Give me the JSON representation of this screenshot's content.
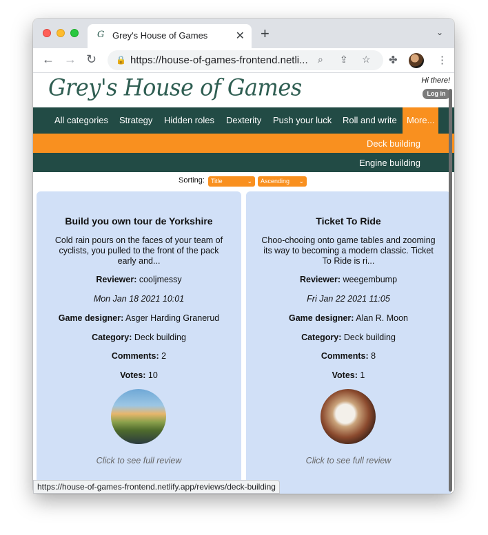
{
  "browser": {
    "tab_title": "Grey's House of Games",
    "tab_favicon": "G",
    "url": "https://house-of-games-frontend.netli...",
    "status_url": "https://house-of-games-frontend.netlify.app/reviews/deck-building"
  },
  "header": {
    "logo": "Grey's House of Games",
    "greeting": "Hi there!",
    "login_label": "Log in"
  },
  "nav": {
    "items": [
      "All categories",
      "Strategy",
      "Hidden roles",
      "Dexterity",
      "Push your luck",
      "Roll and write"
    ],
    "more_label": "More...",
    "dropdown": [
      "Deck building",
      "Engine building"
    ]
  },
  "sorting": {
    "label": "Sorting:",
    "sort_by": "Title",
    "order": "Ascending"
  },
  "reviews": [
    {
      "title": "Build you own tour de Yorkshire",
      "excerpt": "Cold rain pours on the faces of your team of cyclists, you pulled to the front of the pack early and...",
      "reviewer_label": "Reviewer:",
      "reviewer": "cooljmessy",
      "date": "Mon Jan 18 2021 10:01",
      "designer_label": "Game designer:",
      "designer": "Asger Harding Granerud",
      "category_label": "Category:",
      "category": "Deck building",
      "comments_label": "Comments:",
      "comments": "2",
      "votes_label": "Votes:",
      "votes": "10",
      "link": "Click to see full review"
    },
    {
      "title": "Ticket To Ride",
      "excerpt": "Choo-chooing onto game tables and zooming its way to becoming a modern classic. Ticket To Ride is ri...",
      "reviewer_label": "Reviewer:",
      "reviewer": "weegembump",
      "date": "Fri Jan 22 2021 11:05",
      "designer_label": "Game designer:",
      "designer": "Alan R. Moon",
      "category_label": "Category:",
      "category": "Deck building",
      "comments_label": "Comments:",
      "comments": "8",
      "votes_label": "Votes:",
      "votes": "1",
      "link": "Click to see full review"
    }
  ],
  "colors": {
    "nav_bg": "#224b45",
    "accent": "#f9901f",
    "card_bg": "#d1e0f7",
    "logo": "#2f5e52"
  }
}
